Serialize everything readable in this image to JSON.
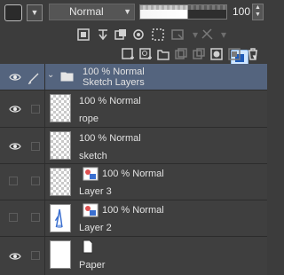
{
  "toolbar": {
    "blend_mode": "Normal",
    "opacity_value": "100",
    "opacity_fraction": 0.55
  },
  "layers": [
    {
      "meta": "100 % Normal",
      "name": "Sketch Layers",
      "type": "folder",
      "selected": true,
      "visible": true
    },
    {
      "meta": "100 % Normal",
      "name": "rope",
      "type": "raster",
      "visible": true
    },
    {
      "meta": "100 % Normal",
      "name": "sketch",
      "type": "raster",
      "visible": true
    },
    {
      "meta": "100 % Normal",
      "name": "Layer 3",
      "type": "vector",
      "visible": false
    },
    {
      "meta": "100 % Normal",
      "name": "Layer 2",
      "type": "vector",
      "visible": false
    },
    {
      "meta": "",
      "name": "Paper",
      "type": "paper",
      "visible": true
    }
  ],
  "icons": {
    "row2": [
      "layer-property-icon",
      "transfer-icon",
      "clipping-icon",
      "reference-icon",
      "draft-icon",
      "mask-icon",
      "ruler-icon",
      "color-swatch-icon"
    ],
    "row3": [
      "new-raster-layer-icon",
      "new-vector-layer-icon",
      "new-folder-icon",
      "copy-layer-icon",
      "merge-icon",
      "mask-add-icon",
      "apply-mask-icon",
      "delete-layer-icon"
    ]
  },
  "colors": {
    "selected_row": "#54647e",
    "panel_bg": "#3f3f3f",
    "accent_blue": "#1e5bb8"
  }
}
